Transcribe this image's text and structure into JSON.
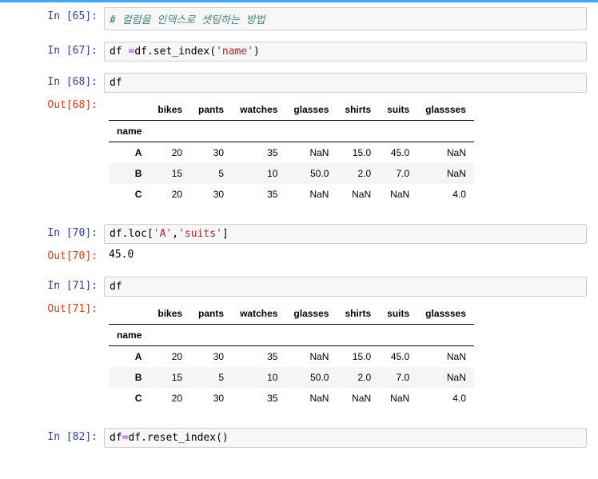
{
  "cells": {
    "c65": {
      "prompt": "In [65]:",
      "comment": "# 컬럼을 인덱스로 셋팅하는 방법"
    },
    "c67": {
      "prompt": "In [67]:",
      "lhs": "df ",
      "op": "=",
      "rhs1": "df.",
      "fn": "set_index",
      "paren_l": "(",
      "str": "'name'",
      "paren_r": ")"
    },
    "c68": {
      "prompt": "In [68]:",
      "code": "df",
      "out_prompt": "Out[68]:"
    },
    "c70": {
      "prompt": "In [70]:",
      "lhs": "df.loc",
      "bracket_l": "[",
      "s1": "'A'",
      "comma": ",",
      "s2": "'suits'",
      "bracket_r": "]",
      "out_prompt": "Out[70]:",
      "out_val": "45.0"
    },
    "c71": {
      "prompt": "In [71]:",
      "code": "df",
      "out_prompt": "Out[71]:"
    },
    "c82": {
      "prompt": "In [82]:",
      "lhs": "df",
      "op": "=",
      "rhs1": "df.",
      "fn": "reset_index",
      "paren_l": "(",
      "paren_r": ")"
    }
  },
  "table": {
    "index_name": "name",
    "columns": [
      "bikes",
      "pants",
      "watches",
      "glasses",
      "shirts",
      "suits",
      "glassses"
    ],
    "rows": [
      {
        "idx": "A",
        "vals": [
          "20",
          "30",
          "35",
          "NaN",
          "15.0",
          "45.0",
          "NaN"
        ]
      },
      {
        "idx": "B",
        "vals": [
          "15",
          "5",
          "10",
          "50.0",
          "2.0",
          "7.0",
          "NaN"
        ]
      },
      {
        "idx": "C",
        "vals": [
          "20",
          "30",
          "35",
          "NaN",
          "NaN",
          "NaN",
          "4.0"
        ]
      }
    ]
  }
}
